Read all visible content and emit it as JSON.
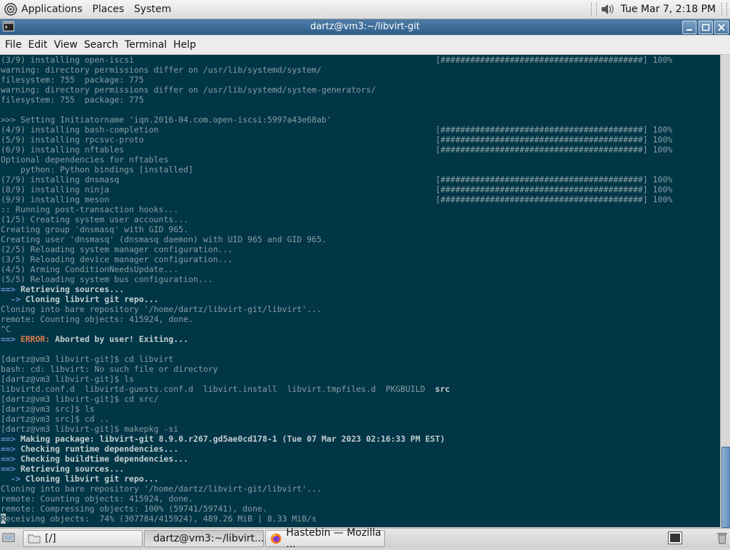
{
  "top_panel": {
    "menus": [
      "Applications",
      "Places",
      "System"
    ],
    "clock": "Tue Mar  7,  2:18 PM"
  },
  "window": {
    "title": "dartz@vm3:~/libvirt-git",
    "menubar": [
      "File",
      "Edit",
      "View",
      "Search",
      "Terminal",
      "Help"
    ]
  },
  "terminal": {
    "progress_bar": "[#########################################]",
    "percent": "100%",
    "lines": [
      {
        "t": "(3/9) installing open-iscsi",
        "r": true
      },
      {
        "t": "warning: directory permissions differ on /usr/lib/systemd/system/"
      },
      {
        "t": "filesystem: 755  package: 775"
      },
      {
        "t": "warning: directory permissions differ on /usr/lib/systemd/system-generators/"
      },
      {
        "t": "filesystem: 755  package: 775"
      },
      {
        "t": ""
      },
      {
        "t": ">>> Setting Initiatorname 'iqn.2016-04.com.open-iscsi:5997a43e68ab'"
      },
      {
        "t": "(4/9) installing bash-completion",
        "r": true
      },
      {
        "t": "(5/9) installing rpcsvc-proto",
        "r": true
      },
      {
        "t": "(6/9) installing nftables",
        "r": true
      },
      {
        "t": "Optional dependencies for nftables"
      },
      {
        "t": "    python: Python bindings [installed]"
      },
      {
        "t": "(7/9) installing dnsmasq",
        "r": true
      },
      {
        "t": "(8/9) installing ninja",
        "r": true
      },
      {
        "t": "(9/9) installing meson",
        "r": true
      },
      {
        "t": ":: Running post-transaction hooks..."
      },
      {
        "t": "(1/5) Creating system user accounts..."
      },
      {
        "t": "Creating group 'dnsmasq' with GID 965."
      },
      {
        "t": "Creating user 'dnsmasq' (dnsmasq daemon) with UID 965 and GID 965."
      },
      {
        "t": "(2/5) Reloading system manager configuration..."
      },
      {
        "t": "(3/5) Reloading device manager configuration..."
      },
      {
        "t": "(4/5) Arming ConditionNeedsUpdate..."
      },
      {
        "t": "(5/5) Reloading system bus configuration..."
      },
      {
        "p": "==>",
        "t": " Retrieving sources...",
        "s": "bold"
      },
      {
        "p": "  ->",
        "t": " Cloning libvirt git repo...",
        "s": "bold"
      },
      {
        "t": "Cloning into bare repository '/home/dartz/libvirt-git/libvirt'..."
      },
      {
        "t": "remote: Counting objects: 415924, done."
      },
      {
        "t": "^C"
      },
      {
        "p": "==>",
        "e": " ERROR:",
        "t": " Aborted by user! Exiting...",
        "s": "error"
      },
      {
        "t": ""
      },
      {
        "t": "[dartz@vm3 libvirt-git]$ cd libvirt"
      },
      {
        "t": "bash: cd: libvirt: No such file or directory"
      },
      {
        "t": "[dartz@vm3 libvirt-git]$ ls"
      },
      {
        "t": "libvirtd.conf.d  libvirtd-guests.conf.d  libvirt.install  libvirt.tmpfiles.d  PKGBUILD  ",
        "d": "src"
      },
      {
        "t": "[dartz@vm3 libvirt-git]$ cd src/"
      },
      {
        "t": "[dartz@vm3 src]$ ls"
      },
      {
        "t": "[dartz@vm3 src]$ cd .."
      },
      {
        "t": "[dartz@vm3 libvirt-git]$ makepkg -si"
      },
      {
        "p": "==>",
        "t": " Making package: libvirt-git 8.9.0.r267.gd5ae0cd178-1 (Tue 07 Mar 2023 02:16:33 PM EST)",
        "s": "bold"
      },
      {
        "p": "==>",
        "t": " Checking runtime dependencies...",
        "s": "bold"
      },
      {
        "p": "==>",
        "t": " Checking buildtime dependencies...",
        "s": "bold"
      },
      {
        "p": "==>",
        "t": " Retrieving sources...",
        "s": "bold"
      },
      {
        "p": "  ->",
        "t": " Cloning libvirt git repo...",
        "s": "bold"
      },
      {
        "t": "Cloning into bare repository '/home/dartz/libvirt-git/libvirt'..."
      },
      {
        "t": "remote: Counting objects: 415924, done."
      },
      {
        "t": "remote: Compressing objects: 100% (59741/59741), done."
      },
      {
        "c": "R",
        "t": "eceiving objects:  74% (307784/415924), 489.26 MiB | 8.33 MiB/s"
      }
    ]
  },
  "taskbar": {
    "tasks": [
      {
        "label": "[/]",
        "icon": "folder-icon"
      },
      {
        "label": "dartz@vm3:~/libvirt...",
        "icon": "terminal-icon",
        "active": true
      },
      {
        "label": "Hastebin — Mozilla ...",
        "icon": "firefox-icon"
      }
    ]
  },
  "colors": {
    "terminal_bg": "#013646",
    "terminal_fg": "#8a9ea5",
    "titlebar": "#3a6a96",
    "error": "#e07a4a",
    "arrow": "#6f8fd6"
  }
}
